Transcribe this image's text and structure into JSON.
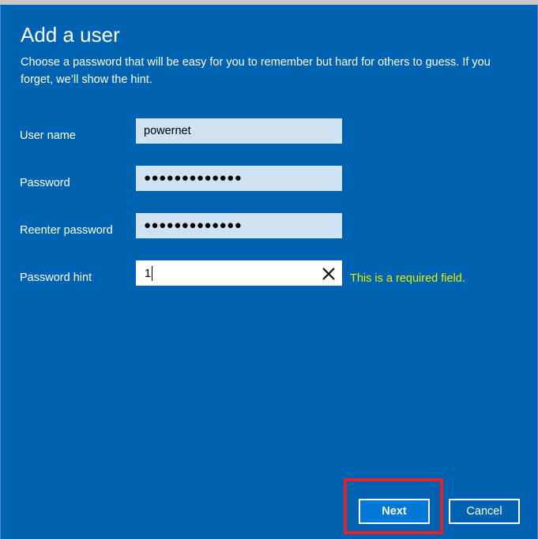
{
  "dialog": {
    "title": "Add a user",
    "description": "Choose a password that will be easy for you to remember but hard for others to guess. If you forget, we’ll show the hint."
  },
  "form": {
    "username_label": "User name",
    "username_value": "powernet",
    "password_label": "Password",
    "password_value": "●●●●●●●●●●●●●",
    "reenter_label": "Reenter password",
    "reenter_value": "●●●●●●●●●●●●●",
    "hint_label": "Password hint",
    "hint_value": "1",
    "hint_error": "This is a required field."
  },
  "buttons": {
    "next_label": "Next",
    "cancel_label": "Cancel"
  },
  "colors": {
    "background": "#0063b1",
    "error": "#e6f200",
    "highlight": "#e8202a"
  },
  "icons": {
    "clear": "close-icon"
  }
}
